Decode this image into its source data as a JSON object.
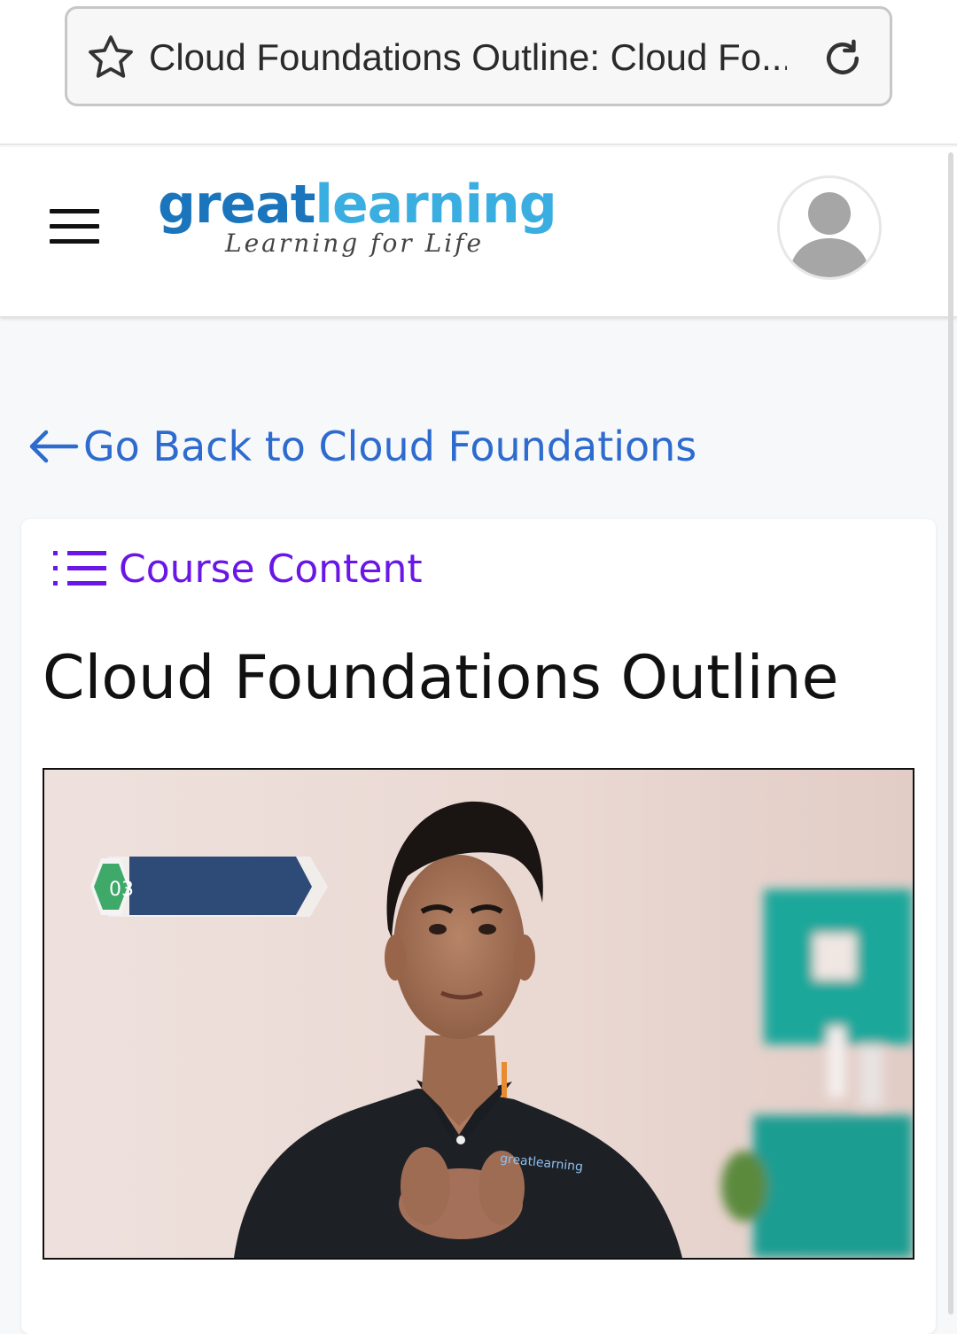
{
  "browser": {
    "tab_title": "Cloud Foundations Outline: Cloud Fo...",
    "star_icon": "star-outline-icon",
    "reload_icon": "reload-icon"
  },
  "header": {
    "menu_icon": "hamburger-menu-icon",
    "logo": {
      "part1": "great",
      "part2": "learning",
      "tagline": "Learning for Life"
    },
    "avatar_icon": "user-avatar-icon"
  },
  "navigation": {
    "back_link_label": "Go Back to Cloud Foundations",
    "back_icon": "arrow-left-icon"
  },
  "content": {
    "course_content_label": "Course Content",
    "course_content_icon": "list-icon",
    "title": "Cloud Foundations Outline"
  },
  "video": {
    "overlay_number": "03",
    "shirt_logo": "greatlearning"
  },
  "colors": {
    "link_blue": "#2d6bcf",
    "accent_purple": "#6a16e6",
    "logo_dark_blue": "#1a75bd",
    "logo_light_blue": "#3aaee0"
  }
}
